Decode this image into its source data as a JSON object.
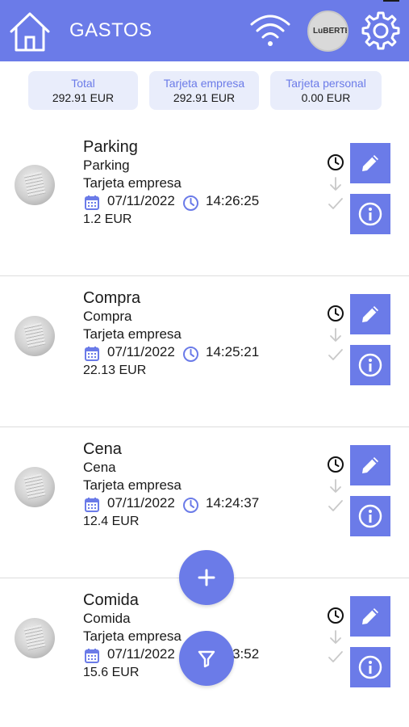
{
  "header": {
    "title": "GASTOS",
    "avatar_logo_text": "LuBERTE",
    "icons": [
      "home-icon",
      "wifi-icon",
      "gear-icon"
    ],
    "accent_color": "#6b7be8"
  },
  "totals": [
    {
      "label": "Total",
      "value": "292.91 EUR"
    },
    {
      "label": "Tarjeta empresa",
      "value": "292.91 EUR"
    },
    {
      "label": "Tarjeta personal",
      "value": "0.00 EUR"
    }
  ],
  "expenses": [
    {
      "name": "Parking",
      "category": "Parking",
      "payment": "Tarjeta empresa",
      "date": "07/11/2022",
      "time": "14:26:25",
      "amount": "1.2 EUR"
    },
    {
      "name": "Compra",
      "category": "Compra",
      "payment": "Tarjeta empresa",
      "date": "07/11/2022",
      "time": "14:25:21",
      "amount": "22.13 EUR"
    },
    {
      "name": "Cena",
      "category": "Cena",
      "payment": "Tarjeta empresa",
      "date": "07/11/2022",
      "time": "14:24:37",
      "amount": "12.4 EUR"
    },
    {
      "name": "Comida",
      "category": "Comida",
      "payment": "Tarjeta empresa",
      "date": "07/11/2022",
      "time": "14:23:52",
      "amount": "15.6 EUR"
    }
  ],
  "fab": {
    "add_icon": "plus-icon",
    "filter_icon": "filter-icon"
  }
}
